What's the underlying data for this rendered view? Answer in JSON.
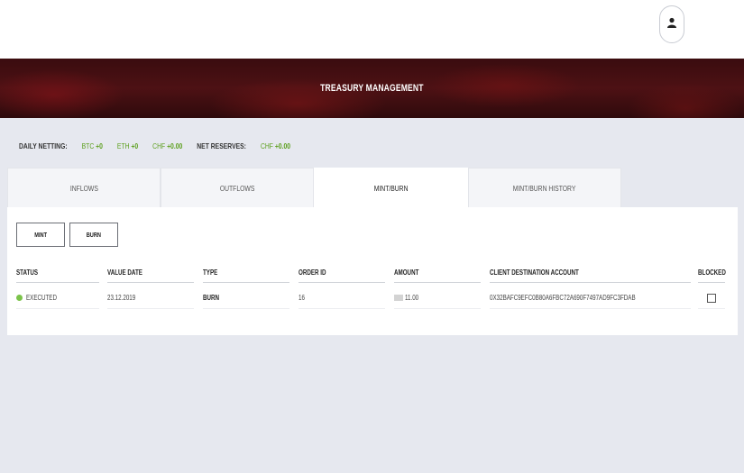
{
  "header": {
    "title": "TREASURY MANAGEMENT",
    "user_icon": "user-icon"
  },
  "summary": {
    "daily_netting_label": "DAILY NETTING:",
    "btc_code": "BTC",
    "btc_value": "+0",
    "eth_code": "ETH",
    "eth_value": "+0",
    "chf_code": "CHF",
    "chf_value": "+0.00",
    "net_reserves_label": "NET RESERVES:",
    "reserves_code": "CHF",
    "reserves_value": "+0.00"
  },
  "tabs": [
    "INFLOWS",
    "OUTFLOWS",
    "MINT/BURN",
    "MINT/BURN HISTORY"
  ],
  "active_tab": "MINT/BURN",
  "actions": {
    "mint_label": "MINT",
    "burn_label": "BURN"
  },
  "table": {
    "columns": [
      "STATUS",
      "VALUE DATE",
      "TYPE",
      "ORDER ID",
      "AMOUNT",
      "CLIENT DESTINATION ACCOUNT",
      "BLOCKED"
    ],
    "rows": [
      {
        "status": "EXECUTED",
        "value_date": "23.12.2019",
        "type": "BURN",
        "order_id": "16",
        "amount": "11.00",
        "client_destination_account": "0X32BAFC9EFC0B80A6FBC72A690F7497AD9FC3FDAB",
        "blocked": false
      }
    ]
  },
  "colors": {
    "accent_green": "#5a9e1a",
    "status_executed": "#7bc34a",
    "banner": "#3a0c0f"
  }
}
